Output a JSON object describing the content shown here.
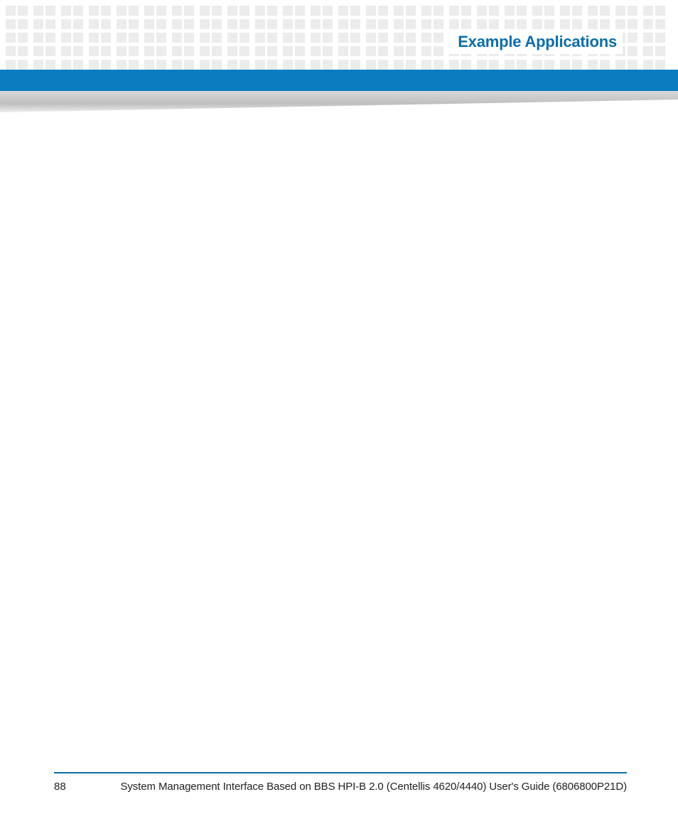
{
  "header": {
    "section_title": "Example Applications"
  },
  "footer": {
    "page_number": "88",
    "document_title": "System Management Interface Based on BBS HPI-B 2.0 (Centellis 4620/4440) User's Guide (6806800P21D)"
  },
  "colors": {
    "accent_blue": "#0a6eab",
    "bar_blue": "#0a7cbf",
    "dot_gray": "#ececec",
    "wedge_gray": "#c7c7c7"
  }
}
